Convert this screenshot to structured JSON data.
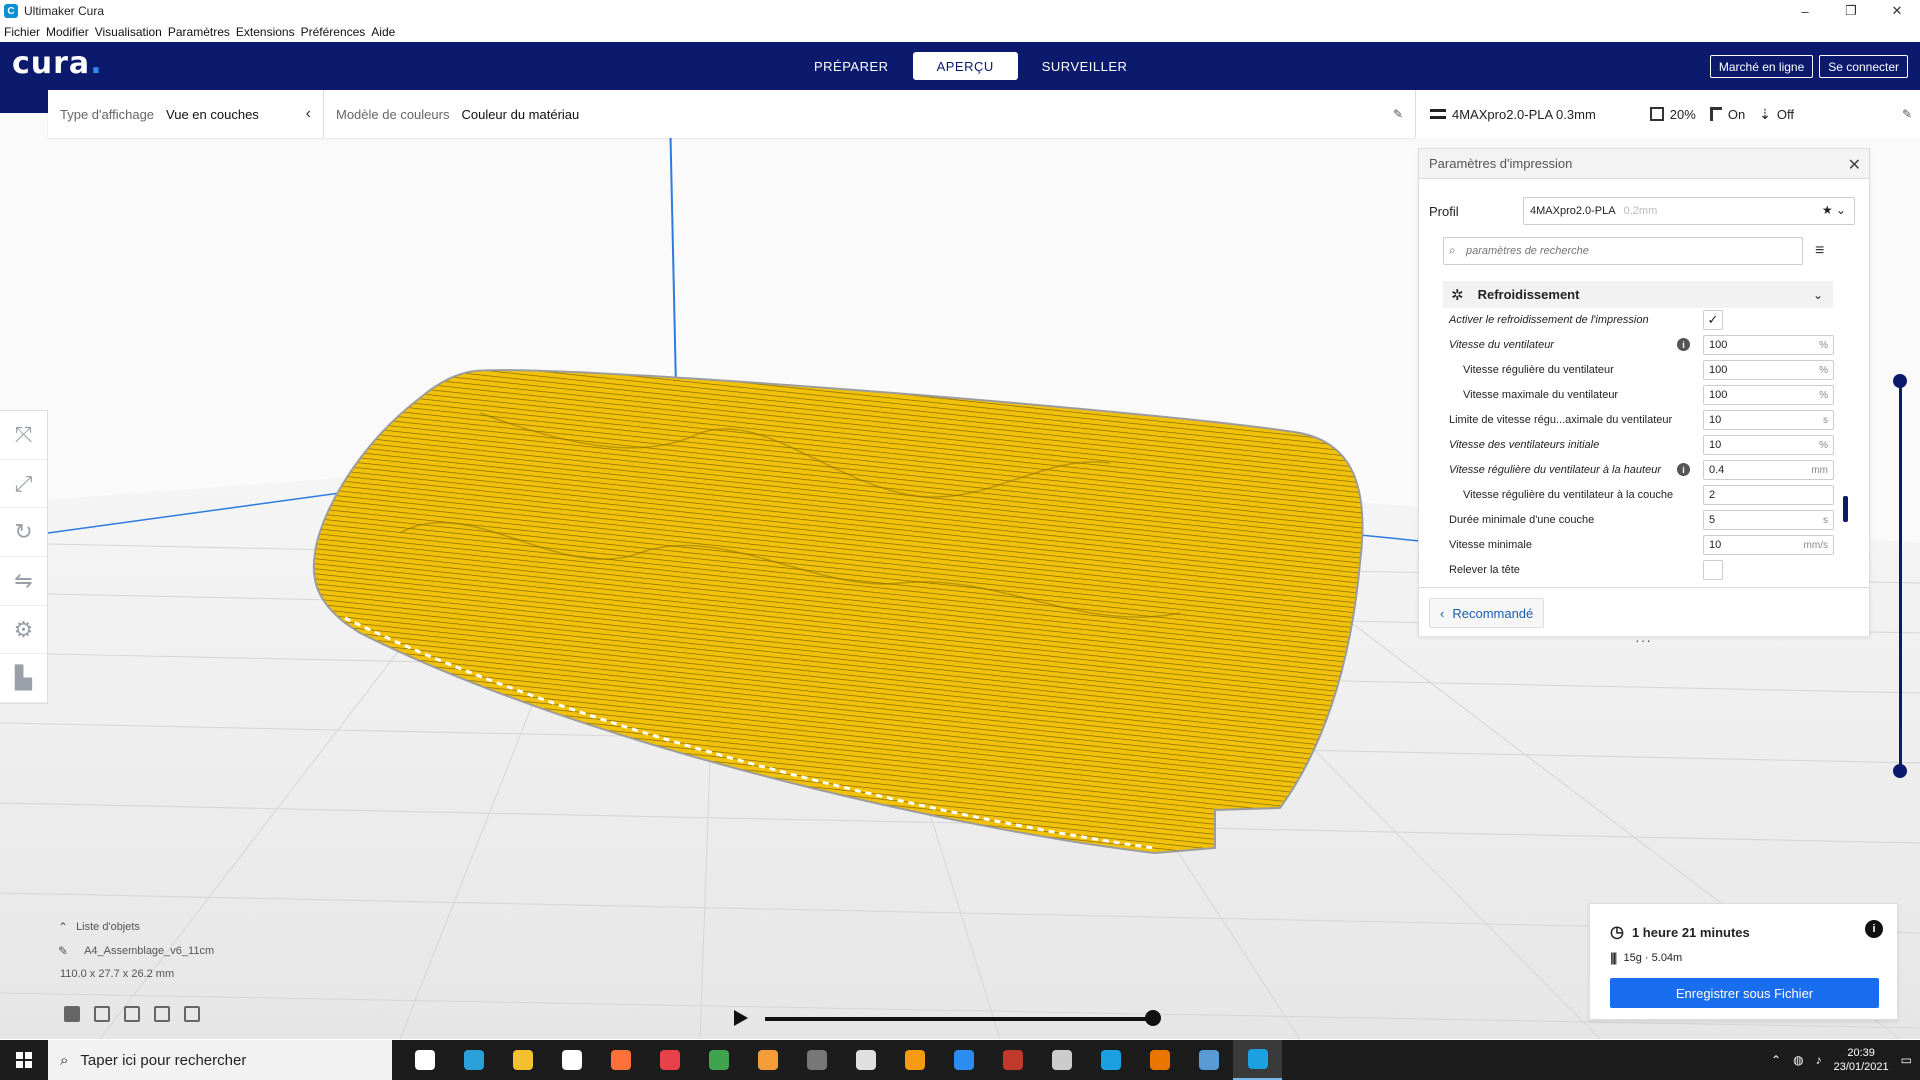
{
  "window": {
    "title": "Ultimaker Cura",
    "controls": [
      "–",
      "❐",
      "✕"
    ]
  },
  "menubar": [
    "Fichier",
    "Modifier",
    "Visualisation",
    "Paramètres",
    "Extensions",
    "Préférences",
    "Aide"
  ],
  "header": {
    "logo_text": "cura",
    "logo_dot": ".",
    "tabs": [
      {
        "label": "PRÉPARER"
      },
      {
        "label": "APERÇU"
      },
      {
        "label": "SURVEILLER"
      }
    ],
    "marketplace_label": "Marché en ligne",
    "signin_label": "Se connecter"
  },
  "view_toolbar": {
    "view_type_label": "Type d'affichage",
    "view_type_value": "Vue en couches",
    "color_scheme_label": "Modèle de couleurs",
    "color_scheme_value": "Couleur du matériau"
  },
  "printer_bar": {
    "profile": "4MAXpro2.0-PLA 0.3mm",
    "infill": "20%",
    "support": "On",
    "adhesion": "Off"
  },
  "settings_panel": {
    "title": "Paramètres d'impression",
    "profile_label": "Profil",
    "profile_value": "4MAXpro2.0-PLA",
    "profile_layer": "0.2mm",
    "search_placeholder": "paramètres de recherche",
    "category": "Refroidissement",
    "settings": [
      {
        "name": "Activer le refroidissement de l'impression",
        "type": "check",
        "checked": true,
        "italic": true,
        "indent": 0
      },
      {
        "name": "Vitesse du ventilateur",
        "value": "100",
        "unit": "%",
        "italic": true,
        "indent": 0,
        "info": true
      },
      {
        "name": "Vitesse régulière du ventilateur",
        "value": "100",
        "unit": "%",
        "italic": false,
        "indent": 1
      },
      {
        "name": "Vitesse maximale du ventilateur",
        "value": "100",
        "unit": "%",
        "italic": false,
        "indent": 1
      },
      {
        "name": "Limite de vitesse régu...aximale du ventilateur",
        "value": "10",
        "unit": "s",
        "italic": false,
        "indent": 0
      },
      {
        "name": "Vitesse des ventilateurs initiale",
        "value": "10",
        "unit": "%",
        "italic": true,
        "indent": 0
      },
      {
        "name": "Vitesse régulière du ventilateur à la hauteur",
        "value": "0.4",
        "unit": "mm",
        "italic": true,
        "indent": 0,
        "info": true
      },
      {
        "name": "Vitesse régulière du ventilateur à la couche",
        "value": "2",
        "unit": "",
        "italic": false,
        "indent": 1
      },
      {
        "name": "Durée minimale d'une couche",
        "value": "5",
        "unit": "s",
        "italic": false,
        "indent": 0
      },
      {
        "name": "Vitesse minimale",
        "value": "10",
        "unit": "mm/s",
        "italic": false,
        "indent": 0
      },
      {
        "name": "Relever la tête",
        "type": "check",
        "checked": false,
        "italic": false,
        "indent": 0
      }
    ],
    "recommended_label": "Recommandé"
  },
  "objects": {
    "list_label": "Liste d'objets",
    "object_name": "A4_Assemblage_v6_11cm",
    "dimensions": "110.0 x 27.7 x 26.2 mm"
  },
  "output": {
    "print_time": "1 heure 21 minutes",
    "material": "15g · 5.04m",
    "save_label": "Enregistrer sous Fichier"
  },
  "taskbar": {
    "search_placeholder": "Taper ici pour rechercher",
    "apps": [
      {
        "name": "task-view",
        "color": "#ffffff"
      },
      {
        "name": "edge",
        "color": "#2a9fd8"
      },
      {
        "name": "file-explorer",
        "color": "#f2c12e"
      },
      {
        "name": "store",
        "color": "#ffffff"
      },
      {
        "name": "firefox",
        "color": "#ff7139"
      },
      {
        "name": "app-red",
        "color": "#e8414a"
      },
      {
        "name": "app-green",
        "color": "#3fa34d"
      },
      {
        "name": "app-orange",
        "color": "#f39c38"
      },
      {
        "name": "app-dark",
        "color": "#777777"
      },
      {
        "name": "app-inkscape",
        "color": "#e0e0e0"
      },
      {
        "name": "app-butterfly",
        "color": "#f39c12"
      },
      {
        "name": "app-compass",
        "color": "#2d8cf0"
      },
      {
        "name": "app-gem",
        "color": "#c0392b"
      },
      {
        "name": "app-chrome",
        "color": "#cccccc"
      },
      {
        "name": "app-cura",
        "color": "#1ba1e2"
      },
      {
        "name": "app-blender",
        "color": "#ea7600"
      },
      {
        "name": "app-calc",
        "color": "#5b9bd5"
      },
      {
        "name": "app-cura-active",
        "color": "#1ba1e2"
      }
    ],
    "time": "20:39",
    "date": "23/01/2021"
  },
  "colors": {
    "header_bg": "#0c1a6e",
    "model_yellow": "#f2c20a",
    "accent_blue": "#196ef0"
  }
}
